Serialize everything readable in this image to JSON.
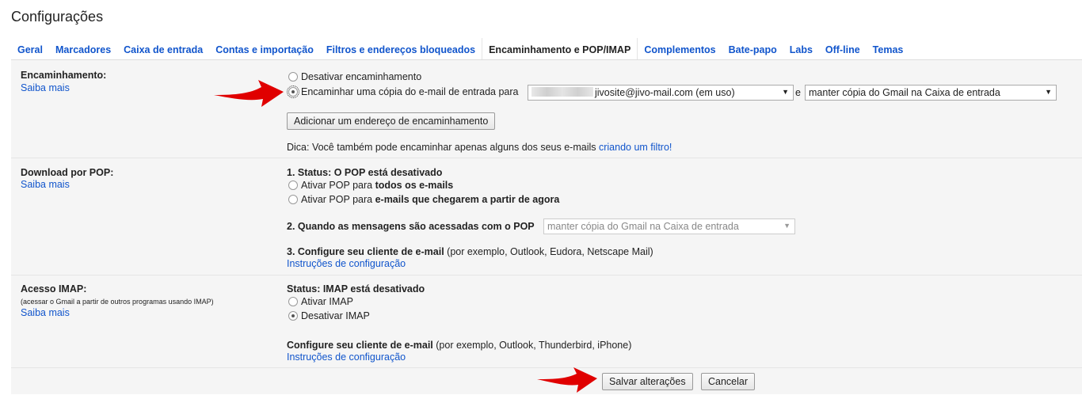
{
  "page": {
    "title": "Configurações"
  },
  "tabs": [
    {
      "label": "Geral"
    },
    {
      "label": "Marcadores"
    },
    {
      "label": "Caixa de entrada"
    },
    {
      "label": "Contas e importação"
    },
    {
      "label": "Filtros e endereços bloqueados"
    },
    {
      "label": "Encaminhamento e POP/IMAP"
    },
    {
      "label": "Complementos"
    },
    {
      "label": "Bate-papo"
    },
    {
      "label": "Labs"
    },
    {
      "label": "Off-line"
    },
    {
      "label": "Temas"
    }
  ],
  "forwarding": {
    "label": "Encaminhamento:",
    "learn_more": "Saiba mais",
    "radio_disable": "Desativar encaminhamento",
    "radio_forward": "Encaminhar uma cópia do e-mail de entrada para",
    "email_select": "jivosite@jivo-mail.com (em uso)",
    "and": "e",
    "action_select": "manter cópia do Gmail na Caixa de entrada",
    "add_button": "Adicionar um endereço de encaminhamento",
    "tip": "Dica: Você também pode encaminhar apenas alguns dos seus e-mails",
    "tip_link": "criando um filtro!"
  },
  "pop": {
    "label": "Download por POP:",
    "learn_more": "Saiba mais",
    "status": "1. Status: O POP está desativado",
    "radio_all_a": "Ativar POP para",
    "radio_all_b": "todos os e-mails",
    "radio_new_a": "Ativar POP para",
    "radio_new_b": "e-mails que chegarem a partir de agora",
    "when_label": "2. Quando as mensagens são acessadas com o POP",
    "when_select": "manter cópia do Gmail na Caixa de entrada",
    "configure_bold": "3. Configure seu cliente de e-mail",
    "configure_rest": "(por exemplo, Outlook, Eudora, Netscape Mail)",
    "instructions": "Instruções de configuração"
  },
  "imap": {
    "label": "Acesso IMAP:",
    "sublabel": "(acessar o Gmail a partir de outros programas usando IMAP)",
    "learn_more": "Saiba mais",
    "status": "Status: IMAP está desativado",
    "radio_enable": "Ativar IMAP",
    "radio_disable": "Desativar IMAP",
    "configure_bold": "Configure seu cliente de e-mail",
    "configure_rest": "(por exemplo, Outlook, Thunderbird, iPhone)",
    "instructions": "Instruções de configuração"
  },
  "footer": {
    "save": "Salvar alterações",
    "cancel": "Cancelar"
  },
  "colors": {
    "link": "#1155cc",
    "arrow": "#e00000",
    "panel": "#f5f5f5"
  },
  "icons": {
    "dropdown": "chevron-down-icon",
    "pointer": "red-arrow-icon"
  }
}
